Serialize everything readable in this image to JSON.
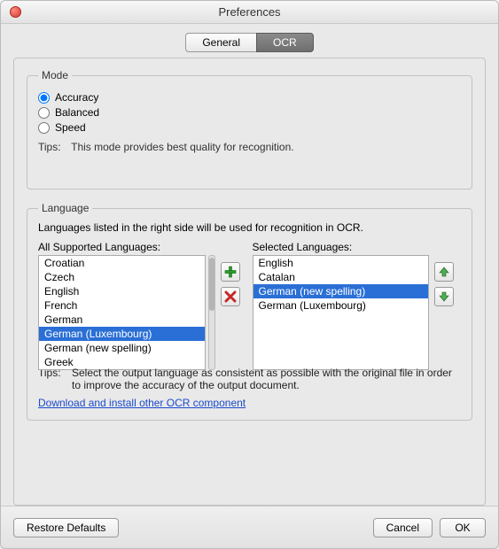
{
  "window": {
    "title": "Preferences"
  },
  "tabs": {
    "general": "General",
    "ocr": "OCR",
    "active": "ocr"
  },
  "mode": {
    "legend": "Mode",
    "accuracy": "Accuracy",
    "balanced": "Balanced",
    "speed": "Speed",
    "selected": "accuracy",
    "tips_label": "Tips:",
    "tips_body": "This mode provides best quality for recognition."
  },
  "language": {
    "legend": "Language",
    "intro": "Languages listed in the right side will be used for recognition in OCR.",
    "all_header": "All Supported Languages:",
    "selected_header": "Selected Languages:",
    "all": [
      "Croatian",
      "Czech",
      "English",
      "French",
      "German",
      "German (Luxembourg)",
      "German (new spelling)",
      "Greek"
    ],
    "all_selected_index": 5,
    "selected": [
      "English",
      "Catalan",
      "German (new spelling)",
      "German (Luxembourg)"
    ],
    "selected_selected_index": 2,
    "tips_label": "Tips:",
    "tips_body": "Select the output language as consistent as possible with the original file in order to improve the accuracy of the output document.",
    "link": "Download and install other OCR component"
  },
  "footer": {
    "restore": "Restore Defaults",
    "cancel": "Cancel",
    "ok": "OK"
  },
  "icons": {
    "add": "plus-icon",
    "remove": "x-icon",
    "up": "arrow-up-icon",
    "down": "arrow-down-icon"
  }
}
